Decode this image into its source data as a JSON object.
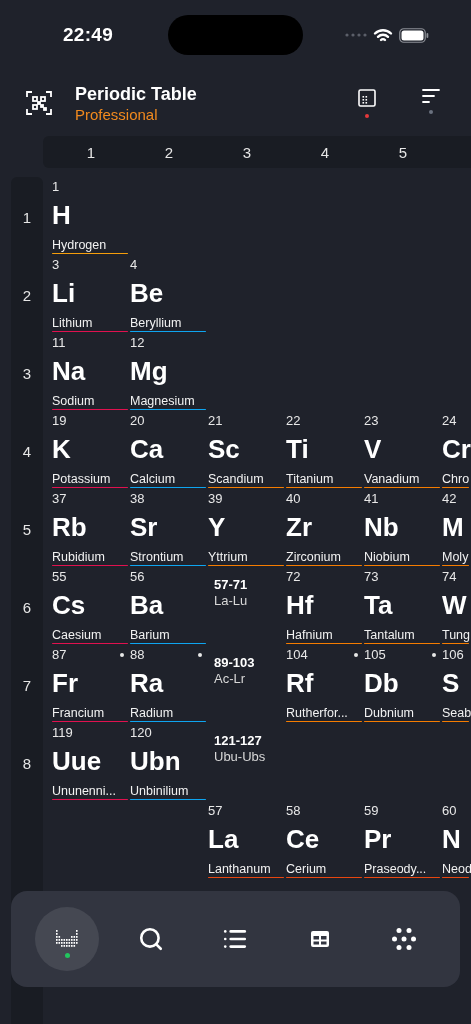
{
  "status_bar": {
    "time": "22:49"
  },
  "header": {
    "title": "Periodic Table",
    "subtitle": "Professional",
    "actions": [
      {
        "kind": "calculator",
        "active": true
      },
      {
        "kind": "sort",
        "active": false
      }
    ]
  },
  "groups": [
    "1",
    "2",
    "3",
    "4",
    "5"
  ],
  "periods": [
    {
      "label": "1",
      "cells": [
        {
          "kind": "element",
          "number": "1",
          "symbol": "H",
          "name": "Hydrogen",
          "color": "#f59e0b",
          "radioactive": false
        }
      ]
    },
    {
      "label": "2",
      "cells": [
        {
          "kind": "element",
          "number": "3",
          "symbol": "Li",
          "name": "Lithium",
          "color": "#e0114f",
          "radioactive": false
        },
        {
          "kind": "element",
          "number": "4",
          "symbol": "Be",
          "name": "Beryllium",
          "color": "#0ea5f0",
          "radioactive": false
        }
      ]
    },
    {
      "label": "3",
      "cells": [
        {
          "kind": "element",
          "number": "11",
          "symbol": "Na",
          "name": "Sodium",
          "color": "#e0114f",
          "radioactive": false
        },
        {
          "kind": "element",
          "number": "12",
          "symbol": "Mg",
          "name": "Magnesium",
          "color": "#0ea5f0",
          "radioactive": false
        }
      ]
    },
    {
      "label": "4",
      "cells": [
        {
          "kind": "element",
          "number": "19",
          "symbol": "K",
          "name": "Potassium",
          "color": "#e0114f",
          "radioactive": false
        },
        {
          "kind": "element",
          "number": "20",
          "symbol": "Ca",
          "name": "Calcium",
          "color": "#0ea5f0",
          "radioactive": false
        },
        {
          "kind": "element",
          "number": "21",
          "symbol": "Sc",
          "name": "Scandium",
          "color": "#f57c00",
          "radioactive": false
        },
        {
          "kind": "element",
          "number": "22",
          "symbol": "Ti",
          "name": "Titanium",
          "color": "#f57c00",
          "radioactive": false
        },
        {
          "kind": "element",
          "number": "23",
          "symbol": "V",
          "name": "Vanadium",
          "color": "#f57c00",
          "radioactive": false
        },
        {
          "kind": "element",
          "number": "24",
          "symbol": "Cr",
          "name": "Chro",
          "color": "#f57c00",
          "radioactive": false
        }
      ]
    },
    {
      "label": "5",
      "cells": [
        {
          "kind": "element",
          "number": "37",
          "symbol": "Rb",
          "name": "Rubidium",
          "color": "#e0114f",
          "radioactive": false
        },
        {
          "kind": "element",
          "number": "38",
          "symbol": "Sr",
          "name": "Strontium",
          "color": "#0ea5f0",
          "radioactive": false
        },
        {
          "kind": "element",
          "number": "39",
          "symbol": "Y",
          "name": "Yttrium",
          "color": "#f57c00",
          "radioactive": false
        },
        {
          "kind": "element",
          "number": "40",
          "symbol": "Zr",
          "name": "Zirconium",
          "color": "#f57c00",
          "radioactive": false
        },
        {
          "kind": "element",
          "number": "41",
          "symbol": "Nb",
          "name": "Niobium",
          "color": "#f57c00",
          "radioactive": false
        },
        {
          "kind": "element",
          "number": "42",
          "symbol": "M",
          "name": "Moly",
          "color": "#f57c00",
          "radioactive": false
        }
      ]
    },
    {
      "label": "6",
      "cells": [
        {
          "kind": "element",
          "number": "55",
          "symbol": "Cs",
          "name": "Caesium",
          "color": "#e0114f",
          "radioactive": false
        },
        {
          "kind": "element",
          "number": "56",
          "symbol": "Ba",
          "name": "Barium",
          "color": "#0ea5f0",
          "radioactive": false
        },
        {
          "kind": "range",
          "numbers": "57-71",
          "symbols": "La-Lu"
        },
        {
          "kind": "element",
          "number": "72",
          "symbol": "Hf",
          "name": "Hafnium",
          "color": "#f57c00",
          "radioactive": false
        },
        {
          "kind": "element",
          "number": "73",
          "symbol": "Ta",
          "name": "Tantalum",
          "color": "#f57c00",
          "radioactive": false
        },
        {
          "kind": "element",
          "number": "74",
          "symbol": "W",
          "name": "Tung",
          "color": "#f57c00",
          "radioactive": false
        }
      ]
    },
    {
      "label": "7",
      "cells": [
        {
          "kind": "element",
          "number": "87",
          "symbol": "Fr",
          "name": "Francium",
          "color": "#e0114f",
          "radioactive": true
        },
        {
          "kind": "element",
          "number": "88",
          "symbol": "Ra",
          "name": "Radium",
          "color": "#0ea5f0",
          "radioactive": true
        },
        {
          "kind": "range",
          "numbers": "89-103",
          "symbols": "Ac-Lr"
        },
        {
          "kind": "element",
          "number": "104",
          "symbol": "Rf",
          "name": "Rutherfor...",
          "color": "#f57c00",
          "radioactive": true
        },
        {
          "kind": "element",
          "number": "105",
          "symbol": "Db",
          "name": "Dubnium",
          "color": "#f57c00",
          "radioactive": true
        },
        {
          "kind": "element",
          "number": "106",
          "symbol": "S",
          "name": "Seab",
          "color": "#f57c00",
          "radioactive": false
        }
      ]
    },
    {
      "label": "8",
      "cells": [
        {
          "kind": "element",
          "number": "119",
          "symbol": "Uue",
          "name": "Ununenni...",
          "color": "#e0114f",
          "radioactive": false
        },
        {
          "kind": "element",
          "number": "120",
          "symbol": "Ubn",
          "name": "Unbinilium",
          "color": "#0ea5f0",
          "radioactive": false
        },
        {
          "kind": "range",
          "numbers": "121-127",
          "symbols": "Ubu-Ubs"
        }
      ]
    }
  ],
  "series": [
    {
      "cells": [
        {
          "kind": "empty"
        },
        {
          "kind": "empty"
        },
        {
          "kind": "element",
          "number": "57",
          "symbol": "La",
          "name": "Lanthanum",
          "color": "#e8460f",
          "radioactive": false
        },
        {
          "kind": "element",
          "number": "58",
          "symbol": "Ce",
          "name": "Cerium",
          "color": "#e8460f",
          "radioactive": false
        },
        {
          "kind": "element",
          "number": "59",
          "symbol": "Pr",
          "name": "Praseody...",
          "color": "#e8460f",
          "radioactive": false
        },
        {
          "kind": "element",
          "number": "60",
          "symbol": "N",
          "name": "Neod",
          "color": "#e8460f",
          "radioactive": false
        }
      ]
    }
  ],
  "nav": [
    {
      "kind": "table",
      "selected": true
    },
    {
      "kind": "search",
      "selected": false
    },
    {
      "kind": "list",
      "selected": false
    },
    {
      "kind": "grid",
      "selected": false
    },
    {
      "kind": "dots",
      "selected": false
    }
  ]
}
